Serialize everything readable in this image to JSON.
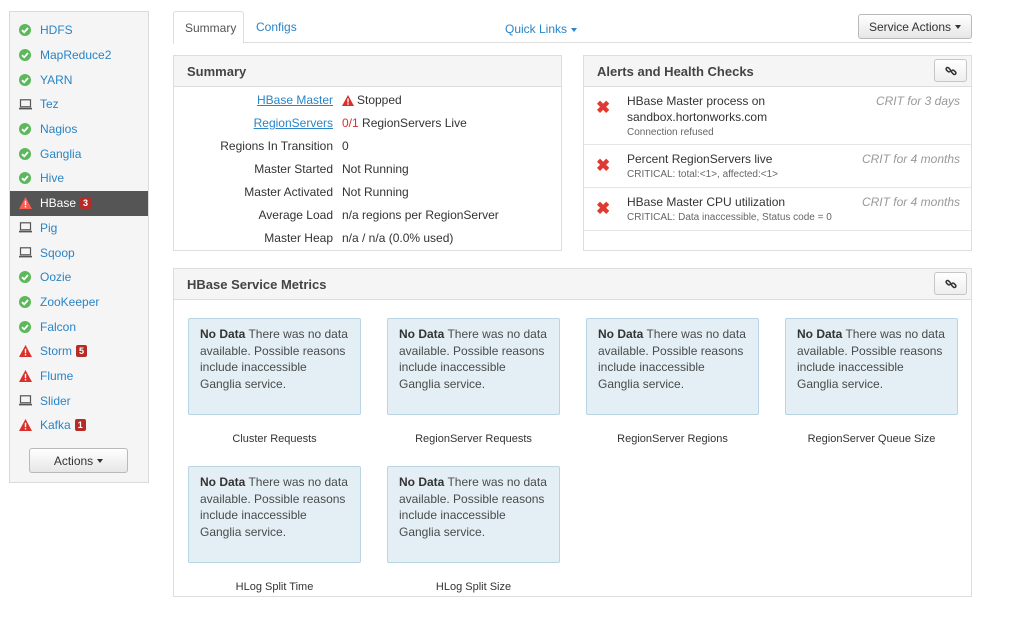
{
  "sidebar": {
    "items": [
      {
        "label": "HDFS",
        "status": "ok"
      },
      {
        "label": "MapReduce2",
        "status": "ok"
      },
      {
        "label": "YARN",
        "status": "ok"
      },
      {
        "label": "Tez",
        "status": "client"
      },
      {
        "label": "Nagios",
        "status": "ok"
      },
      {
        "label": "Ganglia",
        "status": "ok"
      },
      {
        "label": "Hive",
        "status": "ok"
      },
      {
        "label": "HBase",
        "status": "alert",
        "badge": "3"
      },
      {
        "label": "Pig",
        "status": "client"
      },
      {
        "label": "Sqoop",
        "status": "client"
      },
      {
        "label": "Oozie",
        "status": "ok"
      },
      {
        "label": "ZooKeeper",
        "status": "ok"
      },
      {
        "label": "Falcon",
        "status": "ok"
      },
      {
        "label": "Storm",
        "status": "alert",
        "badge": "5"
      },
      {
        "label": "Flume",
        "status": "alert"
      },
      {
        "label": "Slider",
        "status": "client"
      },
      {
        "label": "Kafka",
        "status": "alert",
        "badge": "1"
      }
    ],
    "actions_label": "Actions"
  },
  "tabs": {
    "summary": "Summary",
    "configs": "Configs"
  },
  "quick_links": "Quick Links",
  "service_actions": "Service Actions",
  "summary": {
    "title": "Summary",
    "rows": [
      {
        "label": "HBase Master",
        "value": "Stopped"
      },
      {
        "label": "RegionServers",
        "value_count": "0/1",
        "value": "RegionServers Live"
      },
      {
        "label": "Regions In Transition",
        "value": "0"
      },
      {
        "label": "Master Started",
        "value": "Not Running"
      },
      {
        "label": "Master Activated",
        "value": "Not Running"
      },
      {
        "label": "Average Load",
        "value": "n/a regions per RegionServer"
      },
      {
        "label": "Master Heap",
        "value": "n/a / n/a (0.0% used)"
      }
    ]
  },
  "alerts": {
    "title": "Alerts and Health Checks",
    "items": [
      {
        "title": "HBase Master process on sandbox.hortonworks.com",
        "detail": "Connection refused",
        "when": "CRIT for 3 days"
      },
      {
        "title": "Percent RegionServers live",
        "detail": "CRITICAL: total:<1>, affected:<1>",
        "when": "CRIT for 4 months"
      },
      {
        "title": "HBase Master CPU utilization",
        "detail": "CRITICAL: Data inaccessible, Status code = 0",
        "when": "CRIT for 4 months"
      }
    ]
  },
  "metrics": {
    "title": "HBase Service Metrics",
    "no_data_bold": "No Data",
    "no_data_text": "There was no data available. Possible reasons include inaccessible Ganglia service.",
    "charts": [
      {
        "label": "Cluster Requests"
      },
      {
        "label": "RegionServer Requests"
      },
      {
        "label": "RegionServer Regions"
      },
      {
        "label": "RegionServer Queue Size"
      },
      {
        "label": "HLog Split Time"
      },
      {
        "label": "HLog Split Size"
      }
    ]
  },
  "colors": {
    "ok": "#5cb85c",
    "alert": "#d9302b",
    "link": "#2a84c6",
    "active_bg": "#555555",
    "card_bg": "#e3eff5"
  }
}
